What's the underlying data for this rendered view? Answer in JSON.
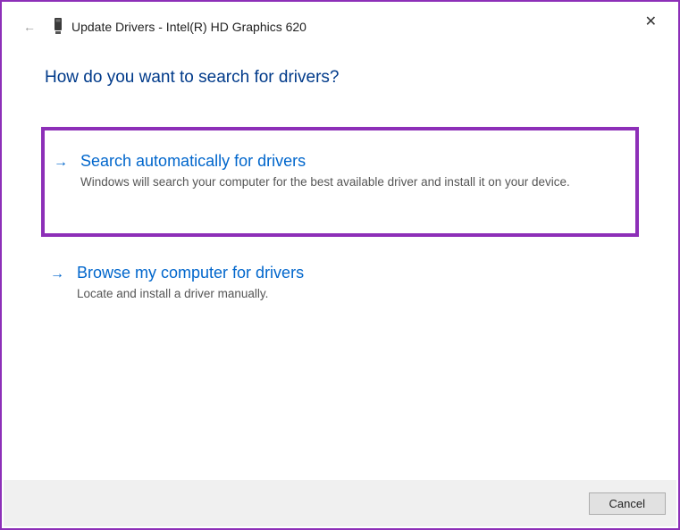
{
  "close": "✕",
  "header": {
    "back": "←",
    "title": "Update Drivers - Intel(R) HD Graphics 620"
  },
  "main": {
    "heading": "How do you want to search for drivers?",
    "options": [
      {
        "arrow": "→",
        "title": "Search automatically for drivers",
        "description": "Windows will search your computer for the best available driver and install it on your device."
      },
      {
        "arrow": "→",
        "title": "Browse my computer for drivers",
        "description": "Locate and install a driver manually."
      }
    ]
  },
  "footer": {
    "cancel": "Cancel"
  },
  "colors": {
    "highlight_border": "#8d2fb8",
    "link_blue": "#0066cc",
    "heading_blue": "#003a8a"
  }
}
